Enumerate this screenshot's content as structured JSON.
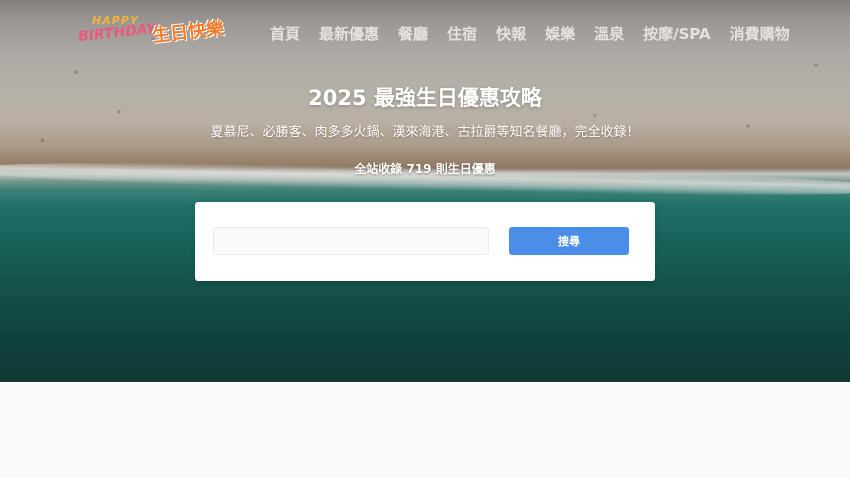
{
  "logo": {
    "happy": "HAPPY",
    "birthday": "BIRTHDAY",
    "chinese": "生日快樂"
  },
  "nav": {
    "items": [
      {
        "label": "首頁"
      },
      {
        "label": "最新優惠"
      },
      {
        "label": "餐廳"
      },
      {
        "label": "住宿"
      },
      {
        "label": "快報"
      },
      {
        "label": "娛樂"
      },
      {
        "label": "溫泉"
      },
      {
        "label": "按摩/SPA"
      },
      {
        "label": "消費購物"
      }
    ]
  },
  "hero": {
    "title": "2025 最強生日優惠攻略",
    "subtitle": "夏慕尼、必勝客、肉多多火鍋、漢來海港、古拉爵等知名餐廳，完全收錄！",
    "count": "全站收錄 719 則生日優惠"
  },
  "search": {
    "value": "",
    "placeholder": "",
    "button_label": "搜尋"
  },
  "colors": {
    "accent": "#4a8ee8",
    "logo_orange": "#f47a2a",
    "logo_pink": "#e95a7c"
  }
}
